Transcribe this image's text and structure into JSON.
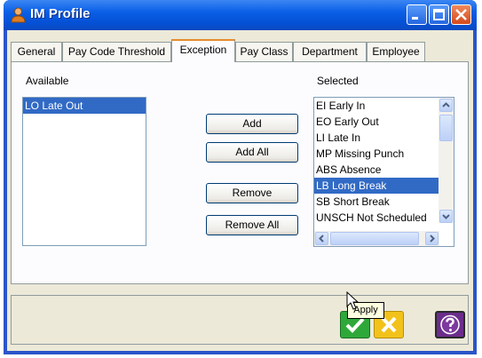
{
  "window": {
    "title": "IM Profile"
  },
  "tabs": [
    {
      "label": "General"
    },
    {
      "label": "Pay Code Threshold"
    },
    {
      "label": "Exception"
    },
    {
      "label": "Pay Class"
    },
    {
      "label": "Department"
    },
    {
      "label": "Employee"
    }
  ],
  "active_tab": "Exception",
  "available": {
    "label": "Available",
    "items": [
      {
        "label": "LO Late Out",
        "selected": true
      }
    ]
  },
  "selected": {
    "label": "Selected",
    "items": [
      {
        "label": "EI Early In"
      },
      {
        "label": "EO Early Out"
      },
      {
        "label": "LI Late In"
      },
      {
        "label": "MP Missing Punch"
      },
      {
        "label": "ABS Absence"
      },
      {
        "label": "LB Long Break",
        "selected": true
      },
      {
        "label": "SB Short Break"
      },
      {
        "label": "UNSCH Not Scheduled"
      }
    ]
  },
  "buttons": {
    "add": "Add",
    "add_all": "Add All",
    "remove": "Remove",
    "remove_all": "Remove All"
  },
  "tooltip": "Apply",
  "colors": {
    "title_bar": "#0a5fe6",
    "selection": "#316ac5",
    "apply_button": "#2fa83a",
    "cancel_button": "#f2c21b",
    "help_button": "#6b2d8c"
  },
  "icons": {
    "title": "person-icon",
    "apply": "checkmark-icon",
    "cancel": "x-icon",
    "help": "question-icon"
  }
}
